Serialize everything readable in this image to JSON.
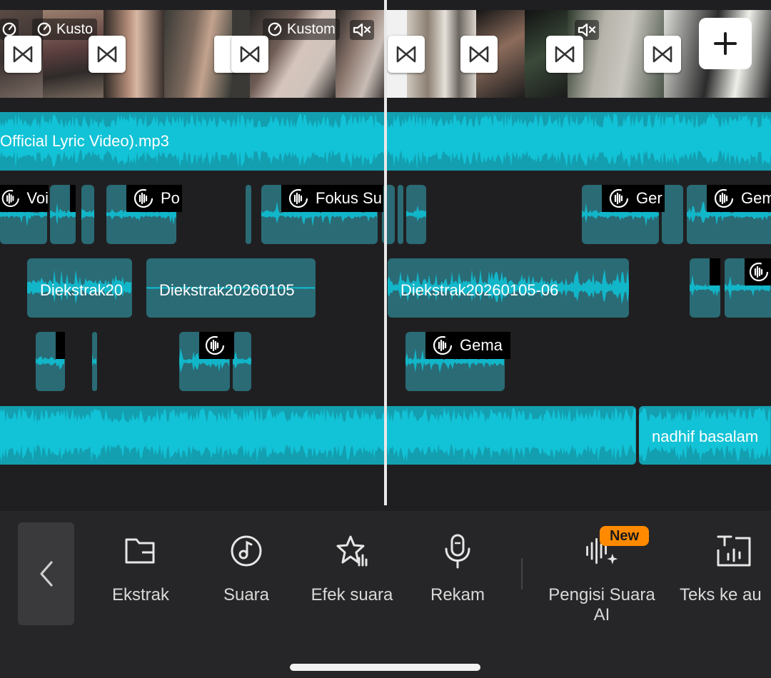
{
  "video_track": {
    "speed_labels": [
      "Kusto",
      "Kustom"
    ],
    "add_clip_icon": "plus-icon",
    "transition_icon": "bowtie-transition-icon",
    "mute_icon": "speaker-muted-icon"
  },
  "audio_tracks": {
    "music_main_label": "Official Lyric Video).mp3",
    "fx_labels": [
      "Voi",
      "Po",
      "Fokus Su",
      "Ger",
      "Gem",
      "Gema"
    ],
    "extract_labels": [
      "Diekstrak20",
      "Diekstrak20260105",
      "Diekstrak20260105-06"
    ],
    "music_second_label": "nadhif basalam"
  },
  "colors": {
    "background": "#1f1f21",
    "clip_teal": "#2a6b75",
    "clip_cyan": "#139fb0",
    "waveform": "#12b6c9",
    "badge_new": "#ff8a00"
  },
  "toolbar": {
    "back_icon": "chevron-left-icon",
    "items": [
      {
        "label": "Ekstrak",
        "icon": "folder-icon"
      },
      {
        "label": "Suara",
        "icon": "music-note-icon"
      },
      {
        "label": "Efek suara",
        "icon": "star-sound-icon"
      },
      {
        "label": "Rekam",
        "icon": "microphone-icon"
      },
      {
        "label": "Pengisi Suara\nAI",
        "icon": "ai-voice-icon"
      },
      {
        "label": "Teks ke au",
        "icon": "text-to-audio-icon"
      }
    ],
    "new_badge": "New"
  }
}
